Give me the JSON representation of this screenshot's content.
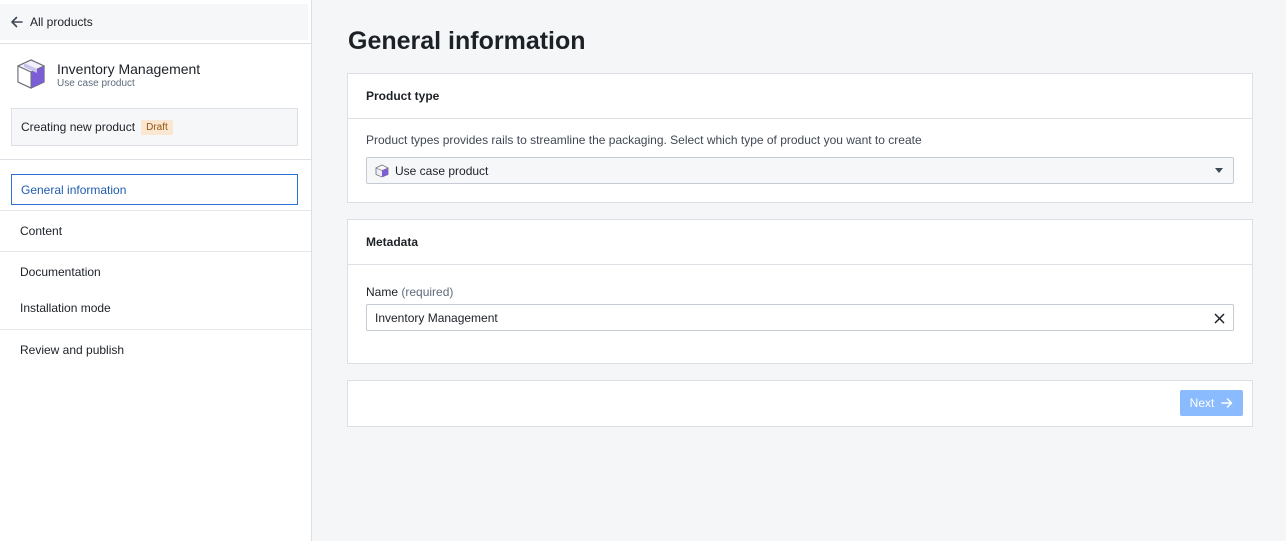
{
  "sidebar": {
    "back_label": "All products",
    "product": {
      "title": "Inventory Management",
      "subtitle": "Use case product"
    },
    "status": {
      "text": "Creating new product",
      "badge": "Draft"
    },
    "nav": [
      {
        "label": "General information",
        "active": true
      },
      {
        "label": "Content"
      },
      {
        "label": "Documentation"
      },
      {
        "label": "Installation mode"
      },
      {
        "label": "Review and publish"
      }
    ]
  },
  "main": {
    "title": "General information",
    "product_type_card": {
      "header": "Product type",
      "description": "Product types provides rails to streamline the packaging. Select which type of product you want to create",
      "selected_value": "Use case product"
    },
    "metadata_card": {
      "header": "Metadata",
      "name_label": "Name",
      "name_required": "(required)",
      "name_value": "Inventory Management"
    },
    "footer": {
      "next_label": "Next"
    }
  },
  "colors": {
    "accent": "#2d72d2",
    "next_disabled": "#8abbff",
    "badge_bg": "#fbe6d2",
    "badge_text": "#935610"
  }
}
